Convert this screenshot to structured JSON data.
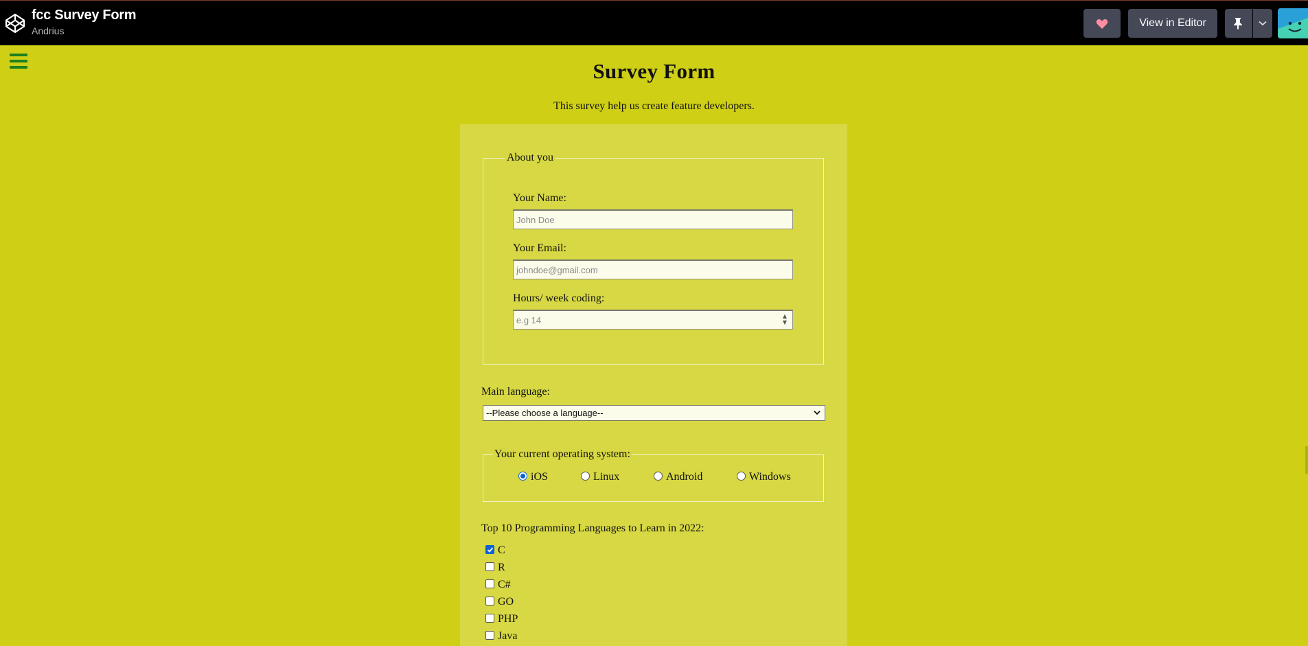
{
  "topbar": {
    "pen_title": "fcc Survey Form",
    "author": "Andrius",
    "view_in_editor": "View in Editor",
    "icons": [
      "codepen-logo-icon",
      "heart-icon",
      "pin-icon",
      "chevron-down-icon",
      "avatar"
    ]
  },
  "page": {
    "title": "Survey Form",
    "description": "This survey help us create feature developers."
  },
  "about": {
    "legend": "About you",
    "name_label": "Your Name:",
    "name_placeholder": "John Doe",
    "email_label": "Your Email:",
    "email_placeholder": "johndoe@gmail.com",
    "hours_label": "Hours/ week coding:",
    "hours_placeholder": "e.g 14"
  },
  "language": {
    "label": "Main language:",
    "selected": "--Please choose a language--"
  },
  "os": {
    "legend": "Your current operating system:",
    "options": [
      "iOS",
      "Linux",
      "Android",
      "Windows"
    ],
    "selected": "iOS"
  },
  "top10": {
    "label": "Top 10 Programming Languages to Learn in 2022:",
    "items": [
      "C",
      "R",
      "C#",
      "GO",
      "PHP",
      "Java"
    ],
    "checked": [
      "C"
    ]
  },
  "colors": {
    "page_bg": "#cfcf16",
    "form_bg": "#d7d843",
    "accent": "#0b62d6",
    "menu_icon": "#1e7f1e"
  }
}
